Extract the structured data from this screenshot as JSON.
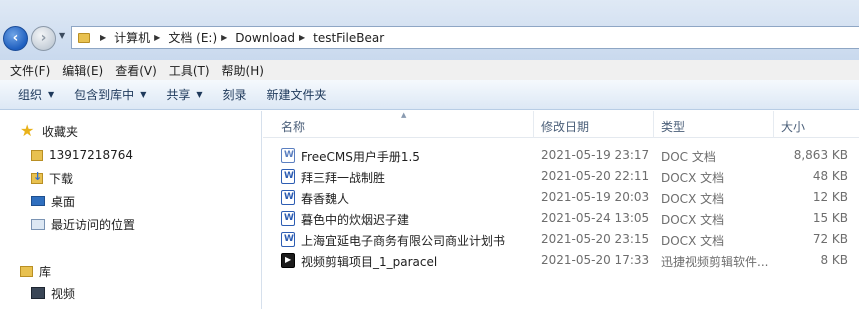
{
  "address": {
    "crumbs": [
      "计算机",
      "文档 (E:)",
      "Download",
      "testFileBear"
    ]
  },
  "menu": [
    "文件(F)",
    "编辑(E)",
    "查看(V)",
    "工具(T)",
    "帮助(H)"
  ],
  "toolbar": {
    "organize": "组织",
    "include_library": "包含到库中",
    "share": "共享",
    "burn": "刻录",
    "new_folder": "新建文件夹"
  },
  "nav": {
    "favorites": "收藏夹",
    "fav_items": [
      "13917218764",
      "下载",
      "桌面",
      "最近访问的位置"
    ],
    "libraries": "库",
    "lib_items": [
      "视频"
    ]
  },
  "columns": {
    "name": "名称",
    "modified": "修改日期",
    "type": "类型",
    "size": "大小"
  },
  "files": [
    {
      "name": "FreeCMS用户手册1.5",
      "modified": "2021-05-19 23:17",
      "type": "DOC 文档",
      "size": "8,863 KB",
      "icon": "word-doc-icon"
    },
    {
      "name": "拜三拜一战制胜",
      "modified": "2021-05-20 22:11",
      "type": "DOCX 文档",
      "size": "48 KB",
      "icon": "word-docx-icon"
    },
    {
      "name": "春香魏人",
      "modified": "2021-05-19 20:03",
      "type": "DOCX 文档",
      "size": "12 KB",
      "icon": "word-docx-icon"
    },
    {
      "name": "暮色中的炊烟迟子建",
      "modified": "2021-05-24 13:05",
      "type": "DOCX 文档",
      "size": "15 KB",
      "icon": "word-docx-icon"
    },
    {
      "name": "上海宜延电子商务有限公司商业计划书",
      "modified": "2021-05-20 23:15",
      "type": "DOCX 文档",
      "size": "72 KB",
      "icon": "word-docx-icon"
    },
    {
      "name": "视频剪辑项目_1_paracel",
      "modified": "2021-05-20 17:33",
      "type": "迅捷视频剪辑软件...",
      "size": "8 KB",
      "icon": "video-project-icon"
    }
  ]
}
